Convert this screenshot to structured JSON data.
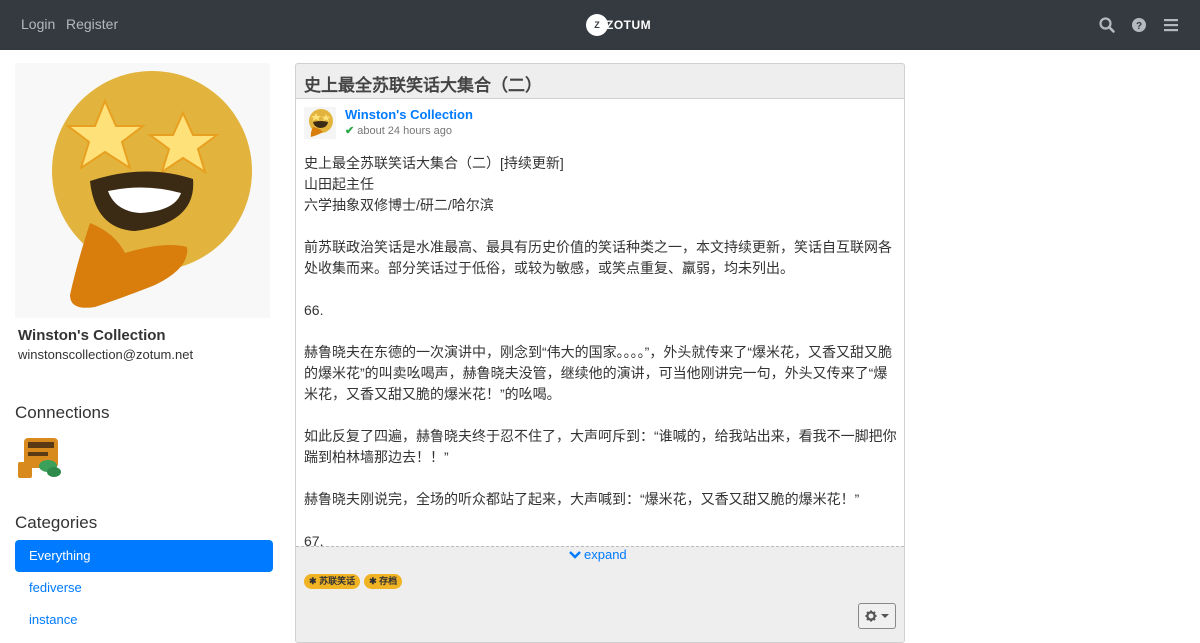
{
  "navbar": {
    "login": "Login",
    "register": "Register",
    "brand": "ZOTUM",
    "brand_disc": "Z"
  },
  "profile": {
    "name": "Winston's Collection",
    "address": "winstonscollection@zotum.net"
  },
  "connections": {
    "title": "Connections"
  },
  "categories": {
    "title": "Categories",
    "items": [
      {
        "label": "Everything",
        "active": true
      },
      {
        "label": "fediverse",
        "active": false
      },
      {
        "label": "instance",
        "active": false
      }
    ]
  },
  "post": {
    "title": "史上最全苏联笑话大集合（二）",
    "author": "Winston's Collection",
    "time": "about 24 hours ago",
    "paragraphs": {
      "p1a": "史上最全苏联笑话大集合（二）[持续更新]",
      "p1b": "山田起主任",
      "p1c": "六学抽象双修博士/研二/哈尔滨",
      "p2": "前苏联政治笑话是水准最高、最具有历史价值的笑话种类之一，本文持续更新，笑话自互联网各处收集而来。部分笑话过于低俗，或较为敏感，或笑点重复、羸弱，均未列出。",
      "p3": "66.",
      "p4": "赫鲁晓夫在东德的一次演讲中，刚念到“伟大的国家。。。。”，外头就传来了“爆米花，又香又甜又脆的爆米花”的叫卖吆喝声，赫鲁晓夫没管，继续他的演讲，可当他刚讲完一句，外头又传来了“爆米花，又香又甜又脆的爆米花！”的吆喝。",
      "p5": "如此反复了四遍，赫鲁晓夫终于忍不住了，大声呵斥到：“谁喊的，给我站出来，看我不一脚把你踹到柏林墙那边去！！”",
      "p6": "赫鲁晓夫刚说完，全场的听众都站了起来，大声喊到：“爆米花，又香又甜又脆的爆米花！”",
      "p7": "67."
    },
    "expand": "expand",
    "tags": [
      "苏联笑话",
      "存档"
    ],
    "tag_glyph": "✱"
  },
  "icons": {
    "search": "search-icon",
    "help": "question-circle-icon",
    "menu": "hamburger-menu-icon",
    "check": "✔"
  },
  "colors": {
    "navbar": "#343a40",
    "accent": "#007bff",
    "tag": "#f0b323",
    "verified": "#28a745"
  }
}
